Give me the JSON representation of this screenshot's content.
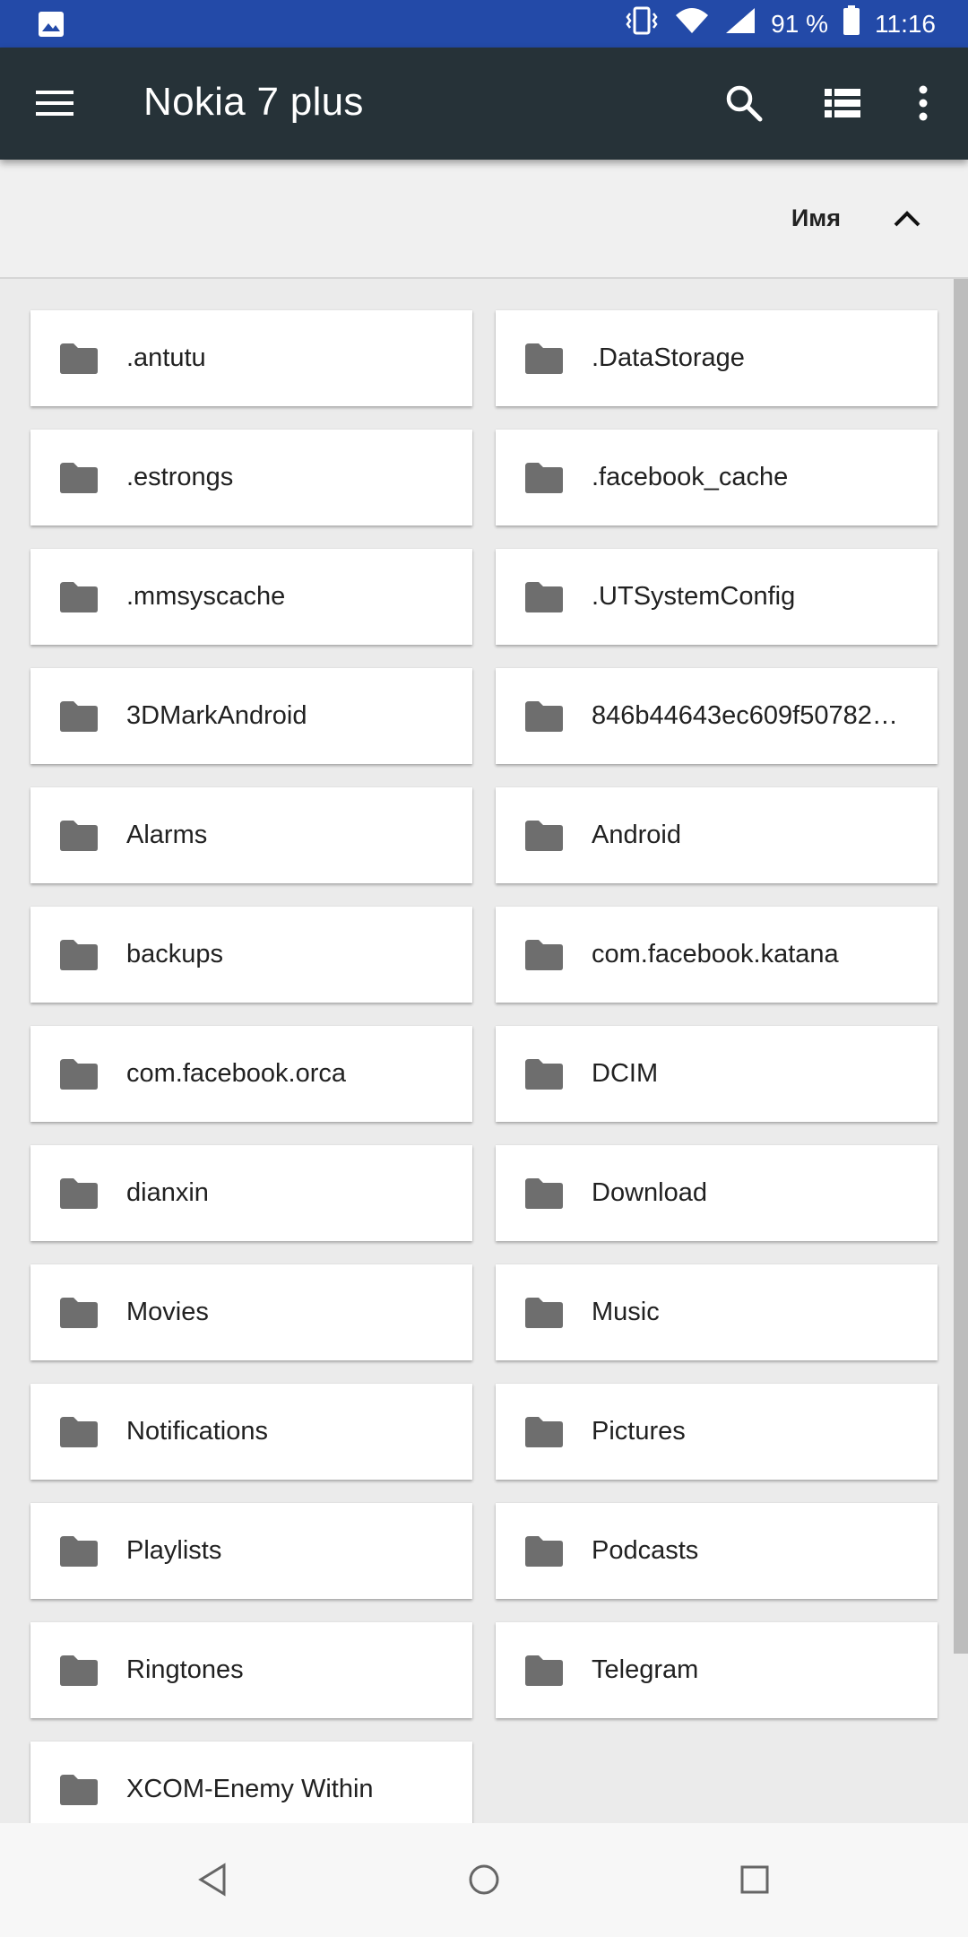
{
  "status_bar": {
    "battery": "91 %",
    "time": "11:16",
    "icons": [
      "image-notification-icon",
      "vibrate-icon",
      "wifi-icon",
      "signal-icon",
      "battery-icon"
    ]
  },
  "app_bar": {
    "title": "Nokia 7 plus",
    "icons": [
      "menu-icon",
      "search-icon",
      "list-view-icon",
      "more-vert-icon"
    ],
    "background": "#263238"
  },
  "sort_bar": {
    "label": "Имя",
    "direction_icon": "chevron-up-icon"
  },
  "folders": [
    ".antutu",
    ".DataStorage",
    ".estrongs",
    ".facebook_cache",
    ".mmsyscache",
    ".UTSystemConfig",
    "3DMarkAndroid",
    "846b44643ec609f50782…",
    "Alarms",
    "Android",
    "backups",
    "com.facebook.katana",
    "com.facebook.orca",
    "DCIM",
    "dianxin",
    "Download",
    "Movies",
    "Music",
    "Notifications",
    "Pictures",
    "Playlists",
    "Podcasts",
    "Ringtones",
    "Telegram",
    "XCOM-Enemy Within"
  ],
  "nav_bar": {
    "icons": [
      "back-icon",
      "home-icon",
      "recents-icon"
    ]
  },
  "colors": {
    "status_bar": "#234aa8",
    "folder_icon": "#6e6e6e"
  }
}
